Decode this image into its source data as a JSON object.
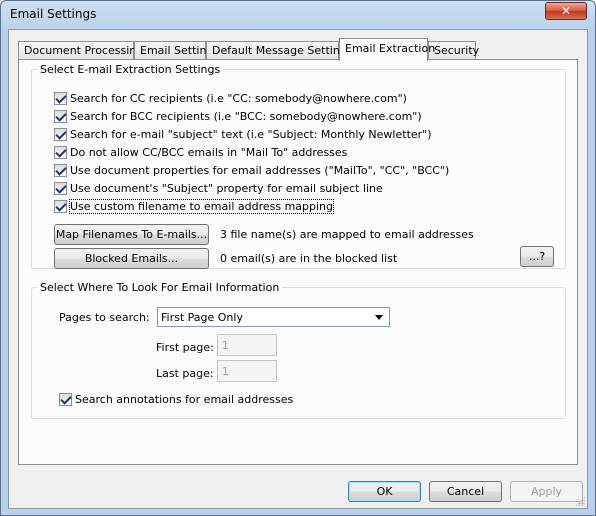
{
  "window": {
    "title": "Email Settings",
    "close_label": "✕"
  },
  "tabs": [
    {
      "label": "Document Processing",
      "active": false
    },
    {
      "label": "Email Setting",
      "active": false
    },
    {
      "label": "Default Message Settings",
      "active": false
    },
    {
      "label": "Email Extraction",
      "active": true
    },
    {
      "label": "Security",
      "active": false
    }
  ],
  "extraction_group": {
    "legend": "Select E-mail Extraction Settings",
    "options": [
      {
        "label": "Search for CC recipients (i.e \"CC: somebody@nowhere.com\")",
        "checked": true
      },
      {
        "label": "Search for BCC recipients (i.e \"BCC: somebody@nowhere.com\")",
        "checked": true
      },
      {
        "label": "Search for e-mail \"subject\" text (i.e \"Subject: Monthly Newletter\")",
        "checked": true
      },
      {
        "label": "Do not allow CC/BCC emails in \"Mail To\" addresses",
        "checked": true
      },
      {
        "label": "Use document properties for email addresses (\"MailTo\", \"CC\", \"BCC\")",
        "checked": true
      },
      {
        "label": "Use document's \"Subject\" property for email subject line",
        "checked": true
      },
      {
        "label": "Use custom filename to email address mapping",
        "checked": true
      }
    ],
    "map_button": "Map Filenames To E-mails...",
    "map_status": "3 file name(s) are mapped to email addresses",
    "blocked_button": "Blocked Emails...",
    "blocked_status": "0 email(s) are in the blocked list",
    "help_button": "...?"
  },
  "lookup_group": {
    "legend": "Select Where To Look For Email Information",
    "pages_label": "Pages to search:",
    "pages_value": "First Page Only",
    "first_page_label": "First page:",
    "first_page_value": "1",
    "last_page_label": "Last page:",
    "last_page_value": "1",
    "annotations_label": "Search annotations for email addresses",
    "annotations_checked": true
  },
  "footer": {
    "ok": "OK",
    "cancel": "Cancel",
    "apply": "Apply"
  }
}
